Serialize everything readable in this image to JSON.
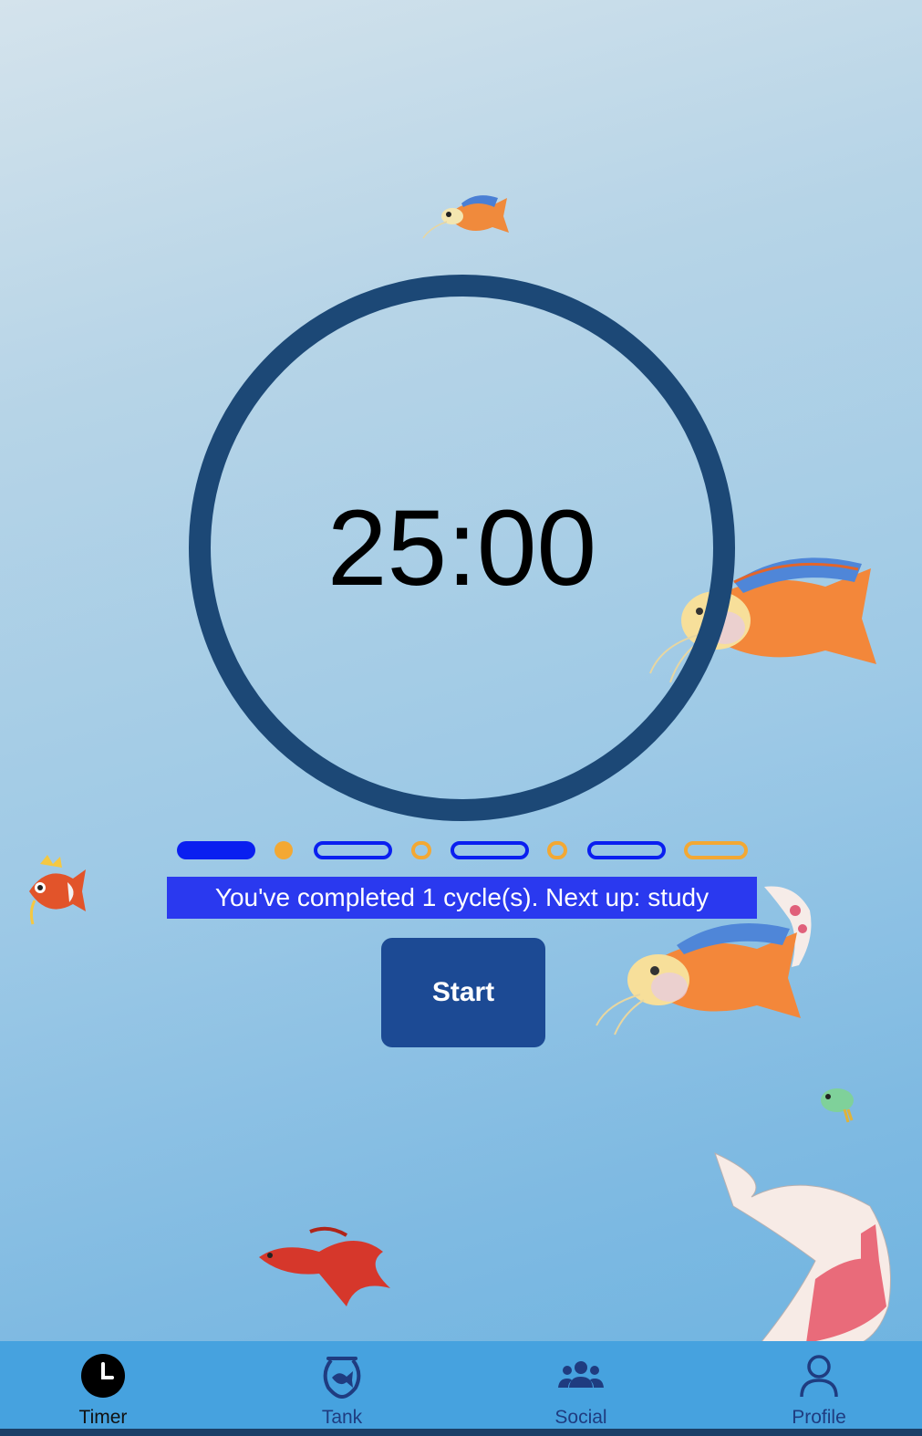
{
  "timer": {
    "time_display": "25:00",
    "ring_color": "#1c4876"
  },
  "cycle_indicators": [
    {
      "type": "study",
      "state": "completed",
      "color": "#0a1ff0"
    },
    {
      "type": "break",
      "state": "completed",
      "color": "#f3a833"
    },
    {
      "type": "study",
      "state": "upcoming",
      "color": "#0a1ff0"
    },
    {
      "type": "break",
      "state": "upcoming",
      "color": "#f3a833"
    },
    {
      "type": "study",
      "state": "upcoming",
      "color": "#0a1ff0"
    },
    {
      "type": "break",
      "state": "upcoming",
      "color": "#f3a833"
    },
    {
      "type": "study",
      "state": "upcoming",
      "color": "#0a1ff0"
    },
    {
      "type": "long-break",
      "state": "upcoming",
      "color": "#f3a833"
    }
  ],
  "status": {
    "message": "You've completed 1 cycle(s). Next up: study"
  },
  "controls": {
    "start_label": "Start"
  },
  "nav": {
    "items": [
      {
        "label": "Timer",
        "icon": "clock-icon",
        "active": true
      },
      {
        "label": "Tank",
        "icon": "fishbowl-icon",
        "active": false
      },
      {
        "label": "Social",
        "icon": "group-icon",
        "active": false
      },
      {
        "label": "Profile",
        "icon": "person-icon",
        "active": false
      }
    ]
  },
  "colors": {
    "accent_blue": "#2a39ef",
    "button_blue": "#1c4a94",
    "nav_background": "#46a2df",
    "break_orange": "#f3a833"
  }
}
